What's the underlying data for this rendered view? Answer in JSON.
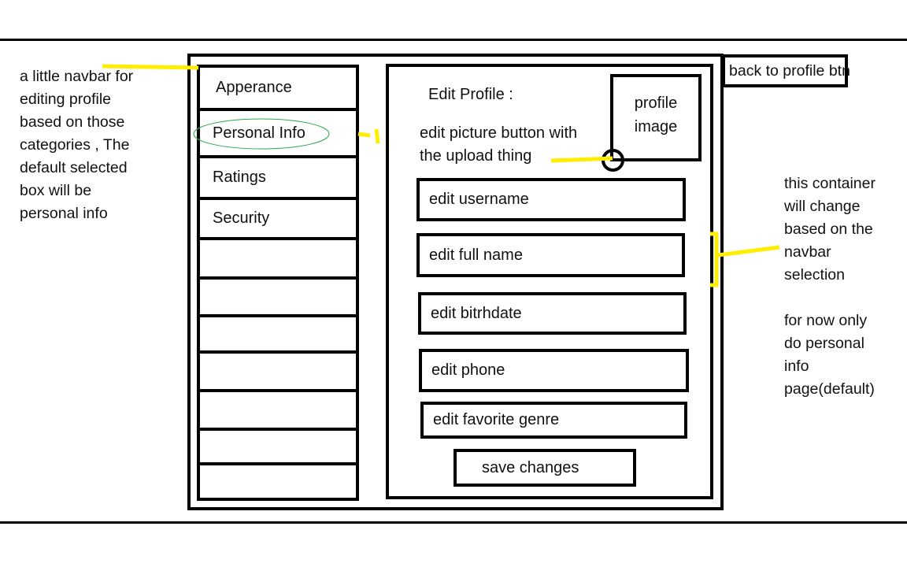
{
  "annotations": {
    "navbar_note": "a little navbar for\nediting profile\nbased on those\ncategories , The\ndefault selected\nbox will be\npersonal info",
    "container_note": "this container\nwill change\nbased on the\nnavbar\nselection\n\nfor now only\ndo personal\ninfo\npage(default)",
    "upload_note": "edit picture button with\nthe upload thing"
  },
  "back_button": "back to profile btn",
  "navbar": {
    "items": [
      {
        "label": "Apperance"
      },
      {
        "label": "Personal Info",
        "selected": true
      },
      {
        "label": "Ratings"
      },
      {
        "label": "Security"
      }
    ]
  },
  "content": {
    "title": "Edit Profile :",
    "profile_image": "profile\nimage",
    "fields": [
      {
        "label": "edit username"
      },
      {
        "label": "edit full name"
      },
      {
        "label": "edit bitrhdate"
      },
      {
        "label": "edit phone"
      },
      {
        "label": "edit favorite genre"
      }
    ],
    "save_button": "save changes"
  },
  "colors": {
    "highlight": "#ffee00",
    "selection_circle": "#2aa84a",
    "ink": "#000000"
  }
}
